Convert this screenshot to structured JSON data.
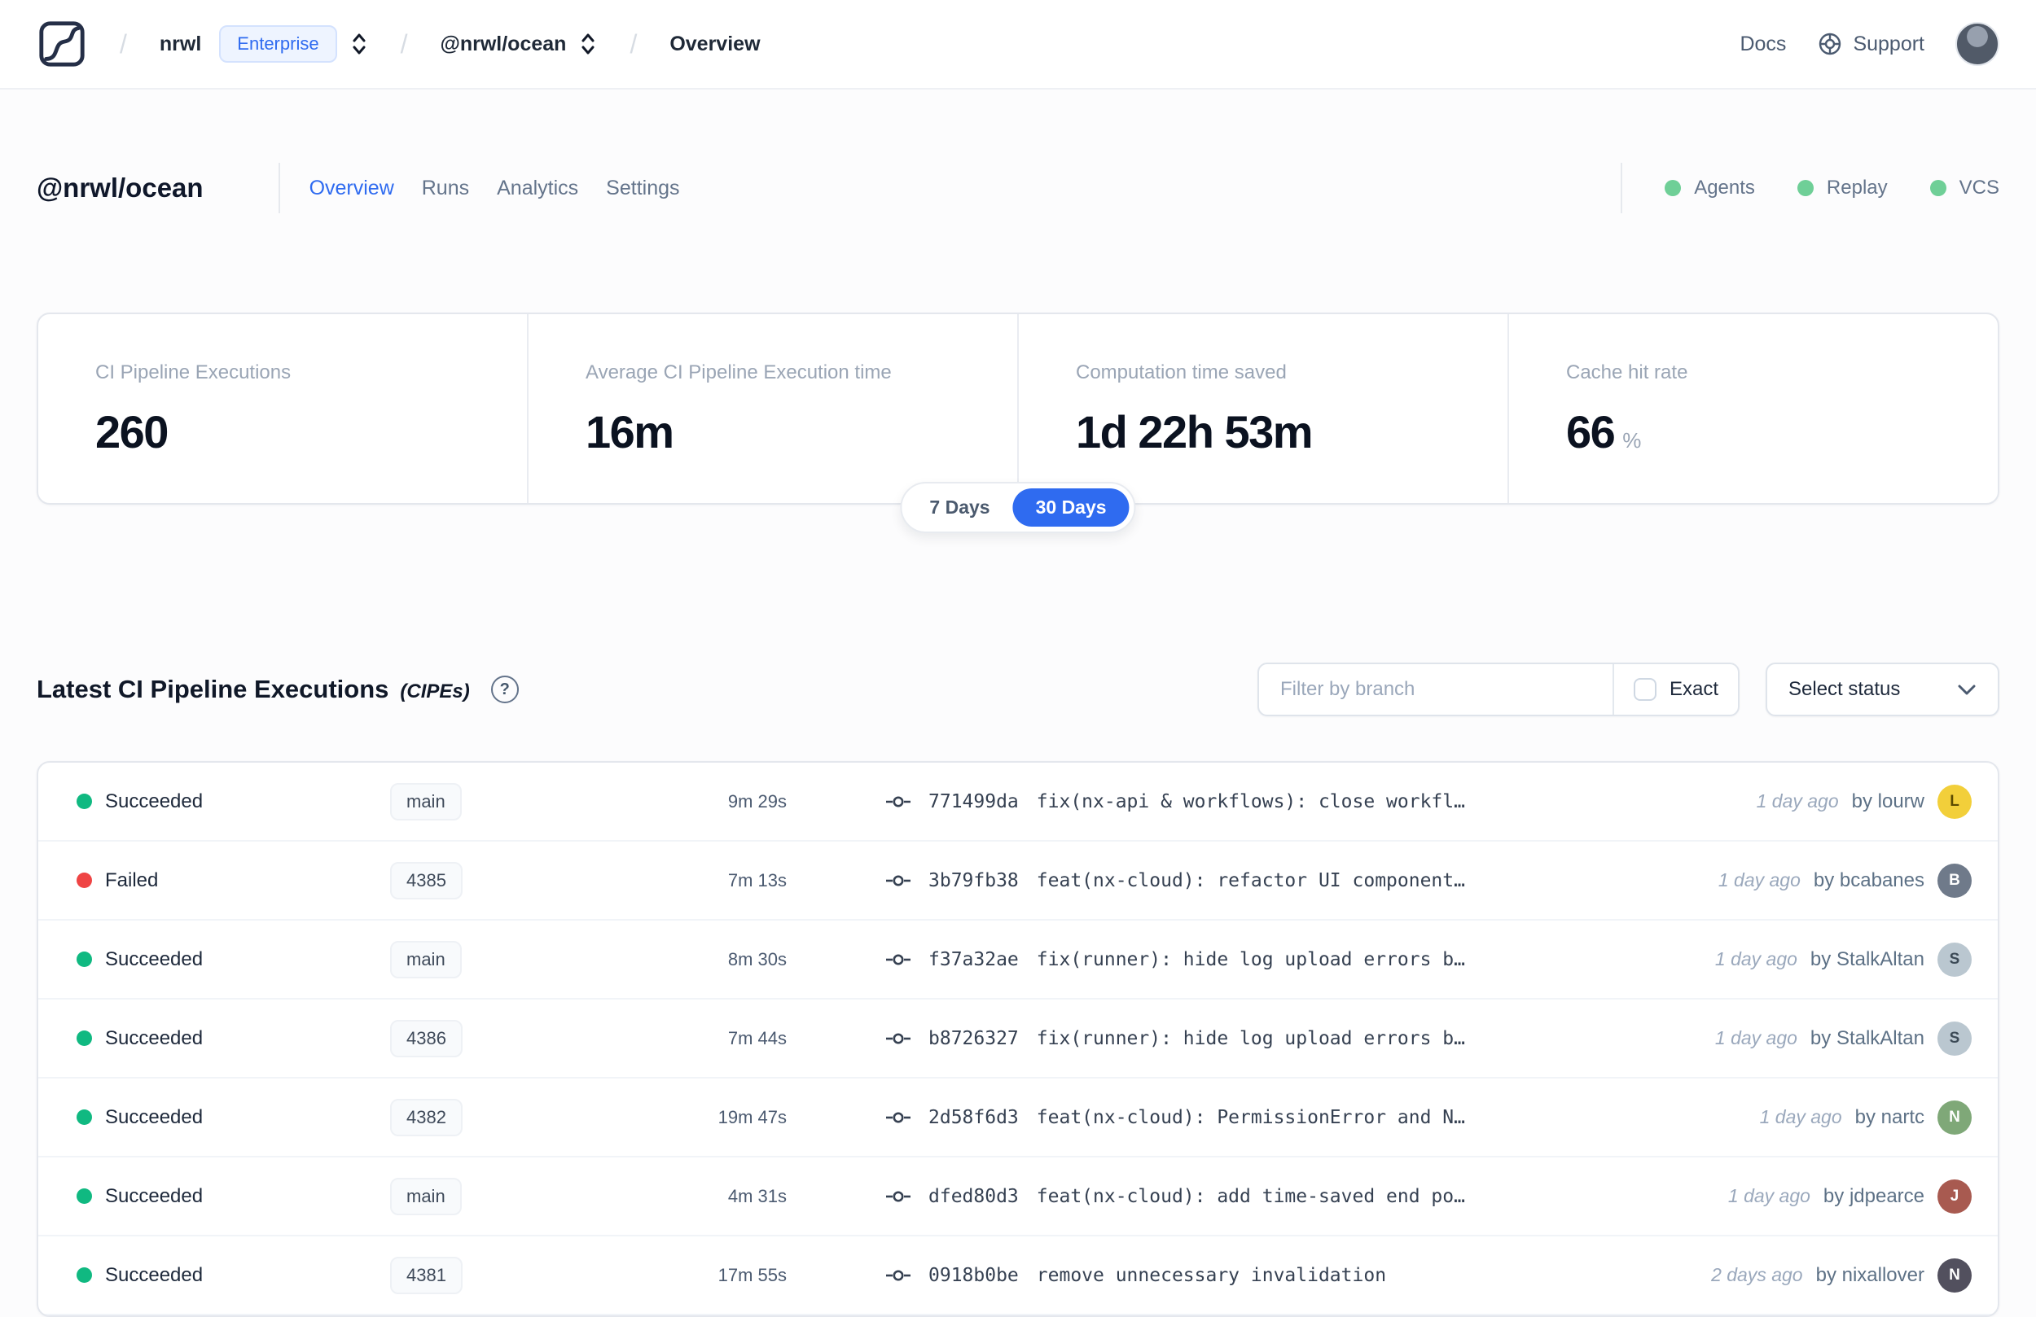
{
  "colors": {
    "accent": "#2f6bf0",
    "success": "#10b981",
    "failure": "#ef4444",
    "indicator_green": "#6fcf97"
  },
  "nav": {
    "org": "nrwl",
    "org_badge": "Enterprise",
    "workspace": "@nrwl/ocean",
    "page": "Overview",
    "docs": "Docs",
    "support": "Support"
  },
  "workspace": {
    "title": "@nrwl/ocean",
    "tabs": [
      {
        "label": "Overview",
        "active": true
      },
      {
        "label": "Runs",
        "active": false
      },
      {
        "label": "Analytics",
        "active": false
      },
      {
        "label": "Settings",
        "active": false
      }
    ],
    "indicators": [
      "Agents",
      "Replay",
      "VCS"
    ]
  },
  "stats": {
    "cards": [
      {
        "label": "CI Pipeline Executions",
        "value": "260",
        "suffix": ""
      },
      {
        "label": "Average CI Pipeline Execution time",
        "value": "16m",
        "suffix": ""
      },
      {
        "label": "Computation time saved",
        "value": "1d 22h 53m",
        "suffix": ""
      },
      {
        "label": "Cache hit rate",
        "value": "66",
        "suffix": "%"
      }
    ],
    "period": {
      "options": [
        "7 Days",
        "30 Days"
      ],
      "selected": "30 Days"
    }
  },
  "section": {
    "title": "Latest CI Pipeline Executions",
    "subtitle": "(CIPEs)",
    "help_icon": "?",
    "filter_placeholder": "Filter by branch",
    "exact_label": "Exact",
    "status_select_label": "Select status"
  },
  "table": {
    "rows": [
      {
        "status": "Succeeded",
        "state": "success",
        "branch": "main",
        "duration": "9m 29s",
        "commit": "771499da",
        "message": "fix(nx-api & workflows): close workfl…",
        "time": "1 day ago",
        "author": "by lourw",
        "avatar_initial": "L",
        "avatar_bg": "#f2cf3a",
        "avatar_fg": "#5b4a00"
      },
      {
        "status": "Failed",
        "state": "failure",
        "branch": "4385",
        "duration": "7m 13s",
        "commit": "3b79fb38",
        "message": "feat(nx-cloud): refactor UI component…",
        "time": "1 day ago",
        "author": "by bcabanes",
        "avatar_initial": "B",
        "avatar_bg": "#6f7a8a",
        "avatar_fg": "#ffffff"
      },
      {
        "status": "Succeeded",
        "state": "success",
        "branch": "main",
        "duration": "8m 30s",
        "commit": "f37a32ae",
        "message": "fix(runner): hide log upload errors b…",
        "time": "1 day ago",
        "author": "by StalkAltan",
        "avatar_initial": "S",
        "avatar_bg": "#bac7d0",
        "avatar_fg": "#3c4a56"
      },
      {
        "status": "Succeeded",
        "state": "success",
        "branch": "4386",
        "duration": "7m 44s",
        "commit": "b8726327",
        "message": "fix(runner): hide log upload errors b…",
        "time": "1 day ago",
        "author": "by StalkAltan",
        "avatar_initial": "S",
        "avatar_bg": "#bac7d0",
        "avatar_fg": "#3c4a56"
      },
      {
        "status": "Succeeded",
        "state": "success",
        "branch": "4382",
        "duration": "19m 47s",
        "commit": "2d58f6d3",
        "message": "feat(nx-cloud): PermissionError and N…",
        "time": "1 day ago",
        "author": "by nartc",
        "avatar_initial": "N",
        "avatar_bg": "#7fa878",
        "avatar_fg": "#ffffff"
      },
      {
        "status": "Succeeded",
        "state": "success",
        "branch": "main",
        "duration": "4m 31s",
        "commit": "dfed80d3",
        "message": "feat(nx-cloud): add time-saved end po…",
        "time": "1 day ago",
        "author": "by jdpearce",
        "avatar_initial": "J",
        "avatar_bg": "#a85a50",
        "avatar_fg": "#ffffff"
      },
      {
        "status": "Succeeded",
        "state": "success",
        "branch": "4381",
        "duration": "17m 55s",
        "commit": "0918b0be",
        "message": "remove unnecessary invalidation",
        "time": "2 days ago",
        "author": "by nixallover",
        "avatar_initial": "N",
        "avatar_bg": "#52505e",
        "avatar_fg": "#ffffff"
      }
    ]
  }
}
